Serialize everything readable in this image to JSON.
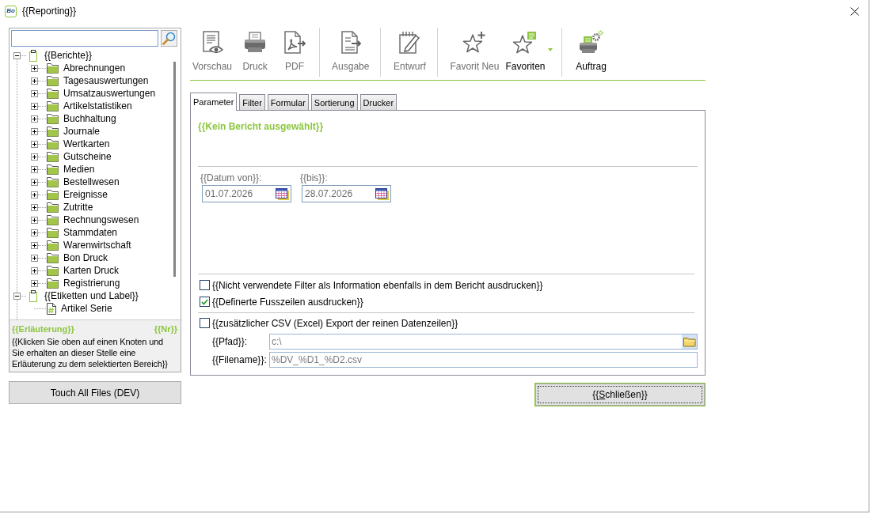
{
  "window": {
    "app_icon_text": "Bo",
    "title": "{{Reporting}}"
  },
  "sidebar": {
    "tree": [
      {
        "kind": "group",
        "label": "{{Berichte}}",
        "expanded": true,
        "children": [
          {
            "kind": "folder",
            "label": "Abrechnungen",
            "expanded": false
          },
          {
            "kind": "folder",
            "label": "Tagesauswertungen",
            "expanded": false
          },
          {
            "kind": "folder",
            "label": "Umsatzauswertungen",
            "expanded": false
          },
          {
            "kind": "folder",
            "label": "Artikelstatistiken",
            "expanded": false
          },
          {
            "kind": "folder",
            "label": "Buchhaltung",
            "expanded": false
          },
          {
            "kind": "folder",
            "label": "Journale",
            "expanded": false
          },
          {
            "kind": "folder",
            "label": "Wertkarten",
            "expanded": false
          },
          {
            "kind": "folder",
            "label": "Gutscheine",
            "expanded": false
          },
          {
            "kind": "folder",
            "label": "Medien",
            "expanded": false
          },
          {
            "kind": "folder",
            "label": "Bestellwesen",
            "expanded": false
          },
          {
            "kind": "folder",
            "label": "Ereignisse",
            "expanded": false
          },
          {
            "kind": "folder",
            "label": "Zutritte",
            "expanded": false
          },
          {
            "kind": "folder",
            "label": "Rechnungswesen",
            "expanded": false
          },
          {
            "kind": "folder",
            "label": "Stammdaten",
            "expanded": false
          },
          {
            "kind": "folder",
            "label": "Warenwirtschaft",
            "expanded": false
          },
          {
            "kind": "folder",
            "label": "Bon Druck",
            "expanded": false
          },
          {
            "kind": "folder",
            "label": "Karten Druck",
            "expanded": false
          },
          {
            "kind": "folder",
            "label": "Registrierung",
            "expanded": false
          }
        ]
      },
      {
        "kind": "group",
        "label": "{{Etiketten und Label}}",
        "expanded": true,
        "children": [
          {
            "kind": "report",
            "label": "Artikel Serie"
          }
        ]
      }
    ],
    "info": {
      "title": "{{Erläuterung}}",
      "number": "{{Nr}}",
      "text": "{{Klicken Sie oben auf einen Knoten und Sie erhalten an dieser Stelle eine Erläuterung zu dem selektierten Bereich}}"
    },
    "dev_button": "Touch All Files (DEV)"
  },
  "toolbar": {
    "groups": [
      {
        "tools": [
          {
            "kind": "preview",
            "label": "Vorschau",
            "disabled": true
          },
          {
            "kind": "print",
            "label": "Druck",
            "disabled": true
          },
          {
            "kind": "pdf",
            "label": "PDF",
            "disabled": true
          }
        ]
      },
      {
        "tools": [
          {
            "kind": "output",
            "label": "Ausgabe",
            "disabled": true
          }
        ]
      },
      {
        "tools": [
          {
            "kind": "draft",
            "label": "Entwurf",
            "disabled": true
          }
        ]
      },
      {
        "tools": [
          {
            "kind": "favorite_new",
            "label": "Favorit Neu",
            "disabled": true
          },
          {
            "kind": "favorites",
            "label": "Favoriten",
            "disabled": false,
            "dropdown": true
          }
        ]
      },
      {
        "tools": [
          {
            "kind": "job",
            "label": "Auftrag",
            "disabled": false
          }
        ]
      }
    ]
  },
  "tabs": [
    {
      "label": "Parameter",
      "selected": true
    },
    {
      "label": "Filter",
      "selected": false
    },
    {
      "label": "Formular",
      "selected": false
    },
    {
      "label": "Sortierung",
      "selected": false
    },
    {
      "label": "Drucker",
      "selected": false
    }
  ],
  "parameter": {
    "report_title": "{{Kein Bericht ausgewählt}}",
    "date_from": {
      "label": "{{Datum von}}:",
      "value": "01.07.2026"
    },
    "date_to": {
      "label": "{{bis}}:",
      "value": "28.07.2026"
    },
    "options": [
      {
        "label": "{{Nicht verwendete Filter als Information ebenfalls in dem Bericht ausdrucken}}",
        "checked": false
      },
      {
        "label": "{{Definerte Fusszeilen ausdrucken}}",
        "checked": true
      }
    ],
    "csv_export": {
      "label": "{{zusätzlicher CSV (Excel) Export der reinen Datenzeilen}}",
      "checked": false,
      "path": {
        "label": "{{Pfad}}:",
        "value": "c:\\"
      },
      "filename": {
        "label": "{{Filename}}:",
        "value": "%DV_%D1_%D2.csv"
      }
    }
  },
  "close_button": {
    "label": "{{Schließen}}"
  }
}
